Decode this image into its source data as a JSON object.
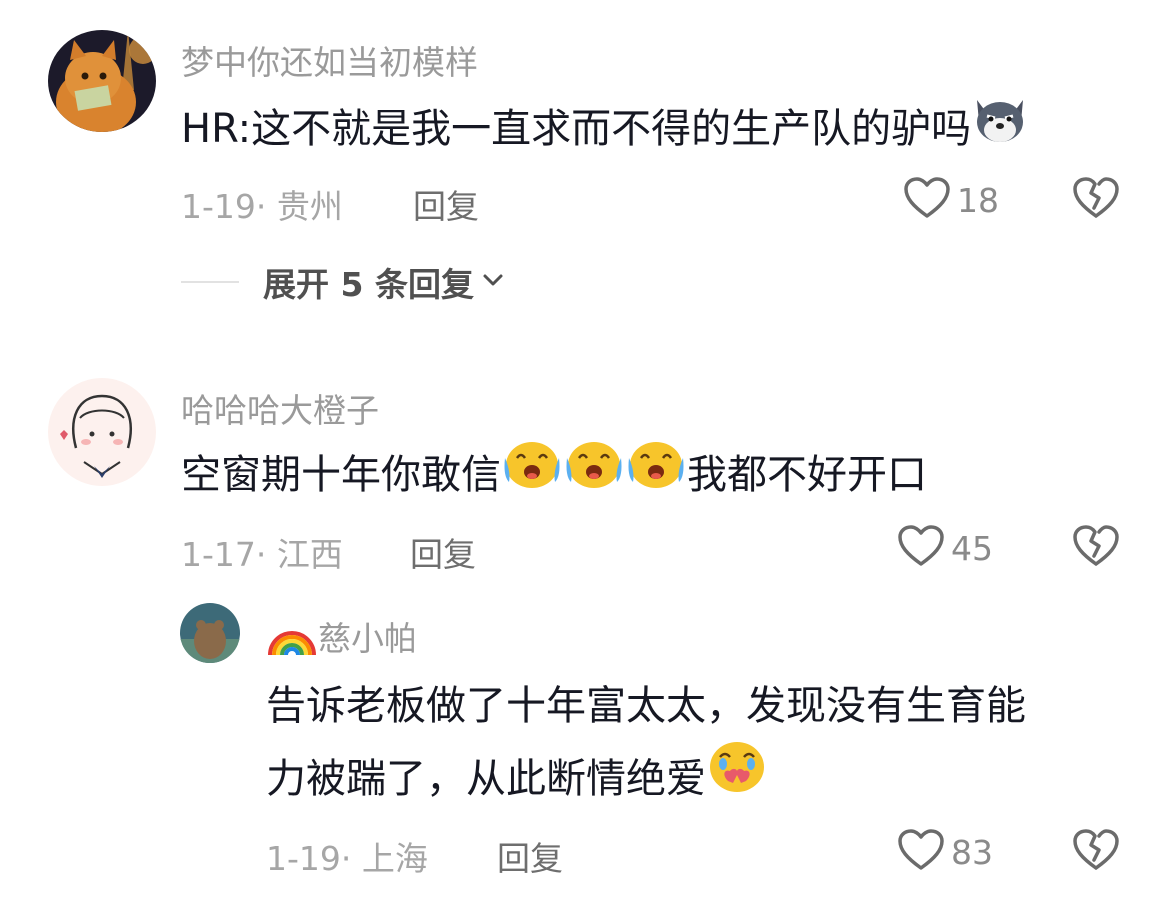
{
  "comments": [
    {
      "username": "梦中你还如当初模样",
      "text": "HR:这不就是我一直求而不得的生产队的驴吗",
      "emoji": "dog-face-emoji",
      "date": "1-19",
      "location": "贵州",
      "reply_label": "回复",
      "likes": "18",
      "expand_label": "展开 5 条回复"
    },
    {
      "username": "哈哈哈大橙子",
      "text_before": "空窗期十年你敢信",
      "emojis": [
        "crying-laughing-emoji",
        "crying-laughing-emoji",
        "crying-laughing-emoji"
      ],
      "text_after": "我都不好开口",
      "date": "1-17",
      "location": "江西",
      "reply_label": "回复",
      "likes": "45",
      "replies": [
        {
          "username": "慈小帕",
          "prefix_emoji": "rainbow-emoji",
          "line1": "告诉老板做了十年富太太，发现没有生育能",
          "line2": "力被踹了，从此断情绝爱",
          "emoji": "heartbroken-crying-emoji",
          "date": "1-19",
          "location": "上海",
          "reply_label": "回复",
          "likes": "83"
        }
      ]
    }
  ],
  "colors": {
    "text": "#161823",
    "muted": "#9a9a9a",
    "icon": "#6b6b6b"
  }
}
